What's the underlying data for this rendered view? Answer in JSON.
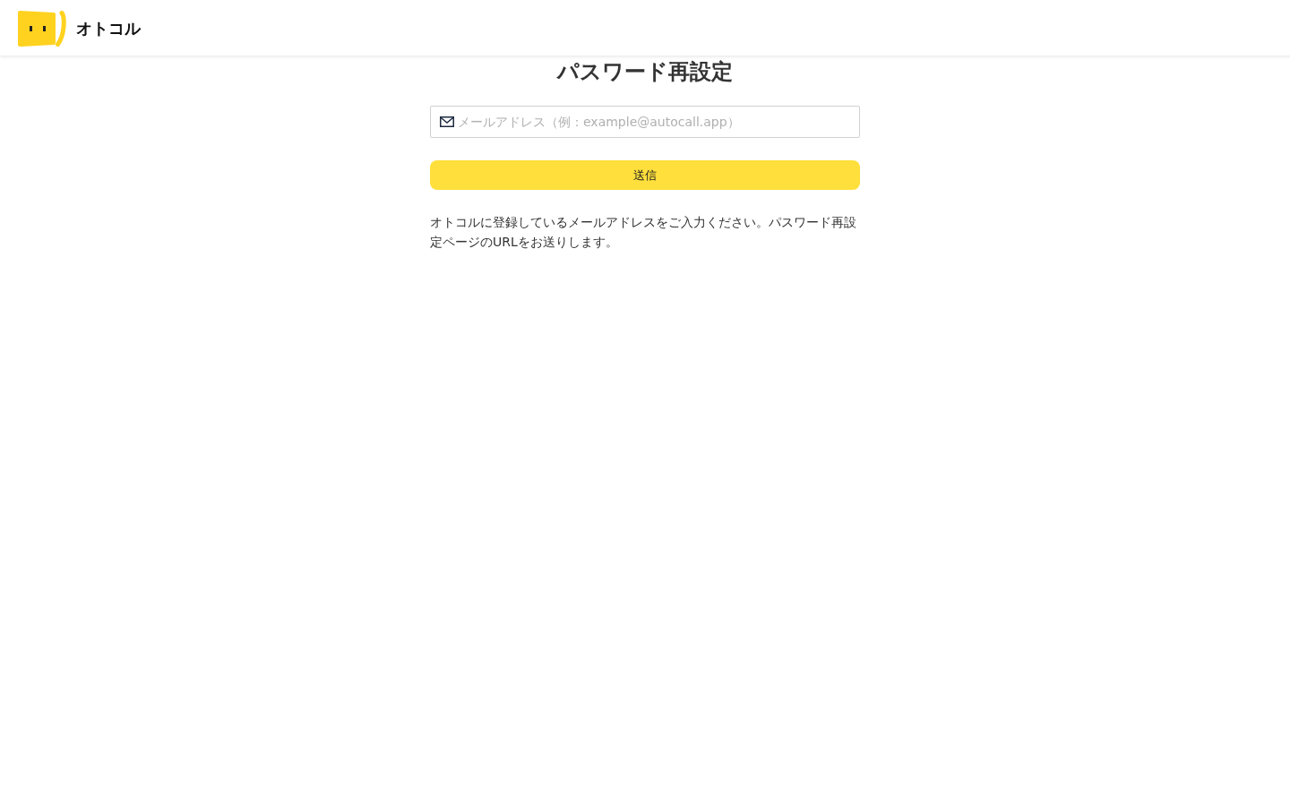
{
  "header": {
    "logo_text": "オトコル"
  },
  "title": "パスワード再設定",
  "email_field": {
    "placeholder": "メールアドレス（例：example@autocall.app）"
  },
  "submit_button": {
    "label": "送信"
  },
  "description": "オトコルに登録しているメールアドレスをご入力ください。パスワード再設定ページのURLをお送りします。"
}
